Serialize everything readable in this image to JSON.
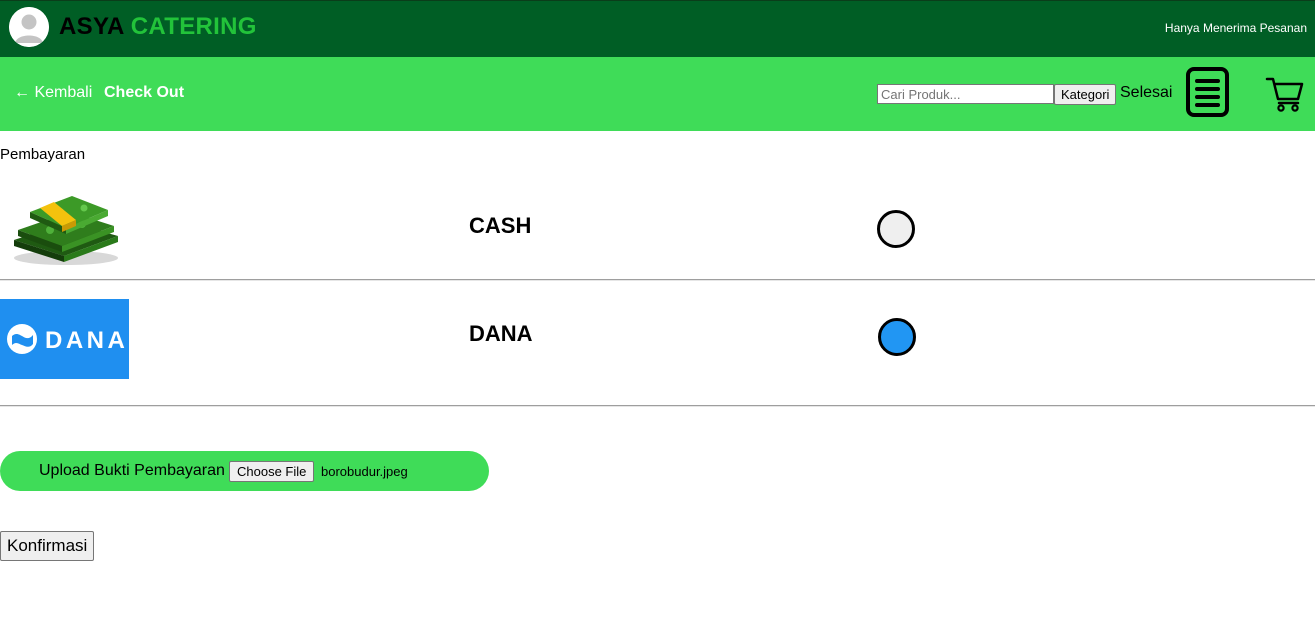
{
  "header": {
    "brand_part1": "ASYA",
    "brand_part2": "CATERING",
    "notice": "Hanya Menerima Pesanan"
  },
  "nav": {
    "back_label": "← Kembali",
    "checkout_label": "Check Out",
    "search_placeholder": "Cari Produk...",
    "category_button": "Kategori",
    "done_label": "Selesai",
    "icons": [
      "user-avatar-icon",
      "document-list-icon",
      "shopping-cart-icon"
    ]
  },
  "payment": {
    "section_title": "Pembayaran",
    "methods": [
      {
        "label": "CASH",
        "selected": false,
        "icon": "money-stack-icon"
      },
      {
        "label": "DANA",
        "selected": true,
        "icon": "dana-logo"
      }
    ],
    "dana_logo_text": "DANA"
  },
  "upload": {
    "label": "Upload Bukti Pembayaran",
    "choose_button": "Choose File",
    "file_name": "borobudur.jpeg"
  },
  "confirm_button": "Konfirmasi",
  "colors": {
    "header_bg": "#005e25",
    "nav_bg": "#3fdc58",
    "brand_accent": "#22c33a",
    "dana_blue": "#1f8ff0",
    "selected_radio": "#2196f3"
  }
}
